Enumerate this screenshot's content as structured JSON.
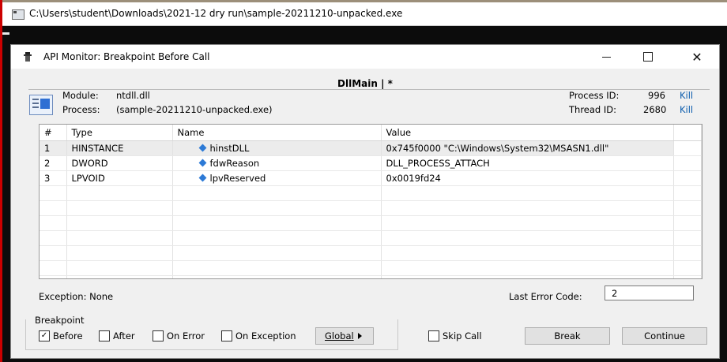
{
  "console": {
    "title": "C:\\Users\\student\\Downloads\\2021-12 dry run\\sample-20211210-unpacked.exe"
  },
  "dialog": {
    "title": "API Monitor: Breakpoint Before Call",
    "controls": {
      "minimize": "—",
      "maximize": "☐",
      "close": "✕"
    },
    "section_title": "DllMain | *",
    "module_label": "Module:",
    "module_value": "ntdll.dll",
    "process_label": "Process:",
    "process_value": "(sample-20211210-unpacked.exe)",
    "process_id_label": "Process ID:",
    "process_id_value": "996",
    "thread_id_label": "Thread ID:",
    "thread_id_value": "2680",
    "kill_label": "Kill",
    "table": {
      "headers": [
        "#",
        "Type",
        "Name",
        "Value"
      ],
      "rows": [
        {
          "num": "1",
          "type": "HINSTANCE",
          "name": "hinstDLL",
          "value": "0x745f0000 \"C:\\Windows\\System32\\MSASN1.dll\""
        },
        {
          "num": "2",
          "type": "DWORD",
          "name": "fdwReason",
          "value": "DLL_PROCESS_ATTACH"
        },
        {
          "num": "3",
          "type": "LPVOID",
          "name": "lpvReserved",
          "value": "0x0019fd24"
        }
      ]
    },
    "exception_text": "Exception: None",
    "last_error_label": "Last Error Code:",
    "last_error_value": "2",
    "breakpoint": {
      "label": "Breakpoint",
      "before": "Before",
      "after": "After",
      "on_error": "On Error",
      "on_exception": "On Exception",
      "global": "Global"
    },
    "skip_call": "Skip Call",
    "break": "Break",
    "continue": "Continue"
  },
  "colors": {
    "link": "#0b5cad",
    "accent": "#2d7ad6"
  }
}
